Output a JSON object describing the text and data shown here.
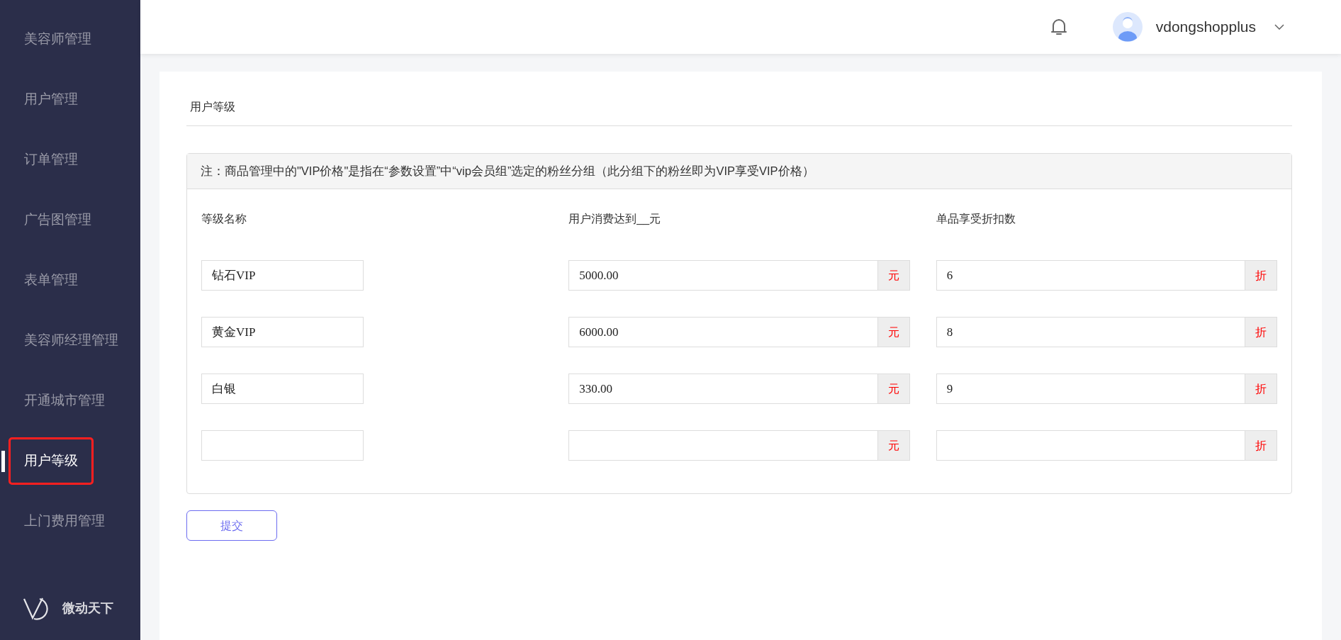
{
  "sidebar": {
    "items": [
      {
        "label": "美容师管理",
        "selected": false,
        "highlighted": false
      },
      {
        "label": "用户管理",
        "selected": false,
        "highlighted": false
      },
      {
        "label": "订单管理",
        "selected": false,
        "highlighted": false
      },
      {
        "label": "广告图管理",
        "selected": false,
        "highlighted": false
      },
      {
        "label": "表单管理",
        "selected": false,
        "highlighted": false
      },
      {
        "label": "美容师经理管理",
        "selected": false,
        "highlighted": false
      },
      {
        "label": "开通城市管理",
        "selected": false,
        "highlighted": false
      },
      {
        "label": "用户等级",
        "selected": true,
        "highlighted": true
      },
      {
        "label": "上门费用管理",
        "selected": false,
        "highlighted": false
      }
    ],
    "logo_text": "微动天下"
  },
  "header": {
    "username": "vdongshopplus"
  },
  "page_title": "用户等级",
  "panel": {
    "note": "注：商品管理中的\"VIP价格\"是指在“参数设置”中“vip会员组”选定的粉丝分组（此分组下的粉丝即为VIP享受VIP价格）",
    "columns": [
      "等级名称",
      "用户消费达到__元",
      "单品享受折扣数"
    ],
    "rows": [
      {
        "name": "钻石VIP",
        "amount": "5000.00",
        "amount_unit": "元",
        "discount": "6",
        "discount_unit": "折"
      },
      {
        "name": "黄金VIP",
        "amount": "6000.00",
        "amount_unit": "元",
        "discount": "8",
        "discount_unit": "折"
      },
      {
        "name": "白银",
        "amount": "330.00",
        "amount_unit": "元",
        "discount": "9",
        "discount_unit": "折"
      },
      {
        "amount_unit": "元",
        "discount_unit": "折"
      }
    ]
  },
  "submit_button": "提交"
}
